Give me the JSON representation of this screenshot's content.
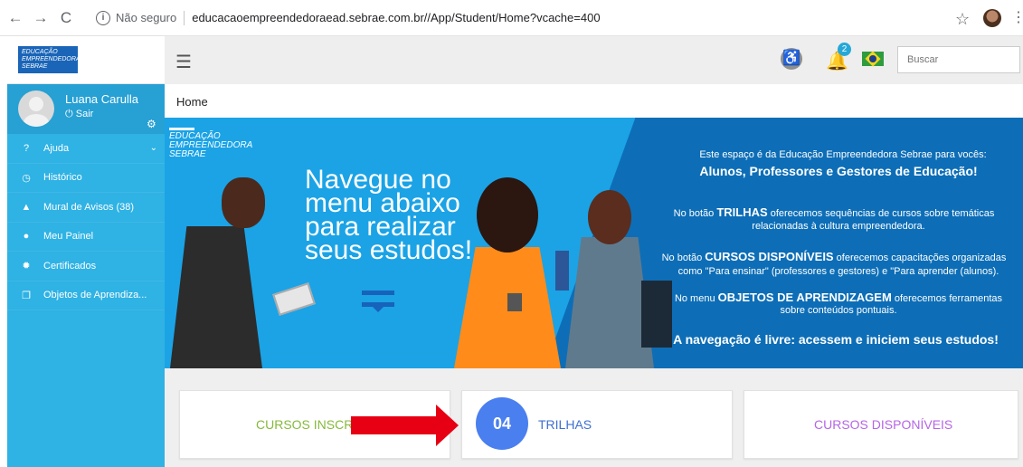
{
  "browser": {
    "back": "←",
    "forward": "→",
    "reload": "C",
    "security": "Não seguro",
    "url": "educacaoempreendedoraead.sebrae.com.br//App/Student/Home?vcache=400"
  },
  "brand": {
    "lines": [
      "EDUCAÇÃO",
      "EMPREENDEDORA",
      "SEBRAE"
    ]
  },
  "user": {
    "name": "Luana Carulla",
    "logout": "Sair"
  },
  "sidebar": {
    "items": [
      {
        "label": "Ajuda",
        "icon": "help-icon",
        "chevron": "⌄"
      },
      {
        "label": "Histórico",
        "icon": "history-icon"
      },
      {
        "label": "Mural de Avisos (38)",
        "icon": "warning-icon"
      },
      {
        "label": "Meu Painel",
        "icon": "user-icon"
      },
      {
        "label": "Certificados",
        "icon": "certificate-icon"
      },
      {
        "label": "Objetos de Aprendiza...",
        "icon": "learning-objects-icon"
      }
    ]
  },
  "topbar": {
    "notifications": "2",
    "search_placeholder": "Buscar"
  },
  "breadcrumb": {
    "current": "Home"
  },
  "banner": {
    "headline_lines": [
      "Navegue no",
      "menu abaixo",
      "para realizar",
      "seus estudos!"
    ],
    "info": {
      "line1": "Este espaço é da Educação Empreendedora Sebrae para vocês:",
      "line2": "Alunos, Professores e Gestores de Educação!",
      "line3_prefix": "No botão ",
      "line3_strong": "TRILHAS",
      "line3_suffix": " oferecemos sequências de cursos sobre temáticas",
      "line4": "relacionadas à cultura empreendedora.",
      "line5_prefix": "No botão ",
      "line5_strong": "CURSOS DISPONÍVEIS",
      "line5_suffix": " oferecemos capacitações organizadas",
      "line6": "como \"Para ensinar\" (professores e gestores) e \"Para aprender (alunos).",
      "line7_prefix": "No menu ",
      "line7_strong": "OBJETOS DE APRENDIZAGEM",
      "line7_suffix": " oferecemos ferramentas",
      "line8": "sobre conteúdos pontuais.",
      "line9": "A navegação é livre: acessem e iniciem seus estudos!"
    }
  },
  "cards": [
    {
      "label": "CURSOS INSCR"
    },
    {
      "count": "04",
      "label": "TRILHAS"
    },
    {
      "label": "CURSOS DISPONÍVEIS"
    }
  ],
  "colors": {
    "sidebar": "#2fb2e4",
    "sidebar_user": "#27a0d4",
    "banner_left": "#1ba3e6",
    "banner_right": "#0d6eb7",
    "course_registered": "#86b93c",
    "tracks": "#3f6fd0",
    "available_courses": "#b565e6",
    "arrow": "#e70013"
  }
}
